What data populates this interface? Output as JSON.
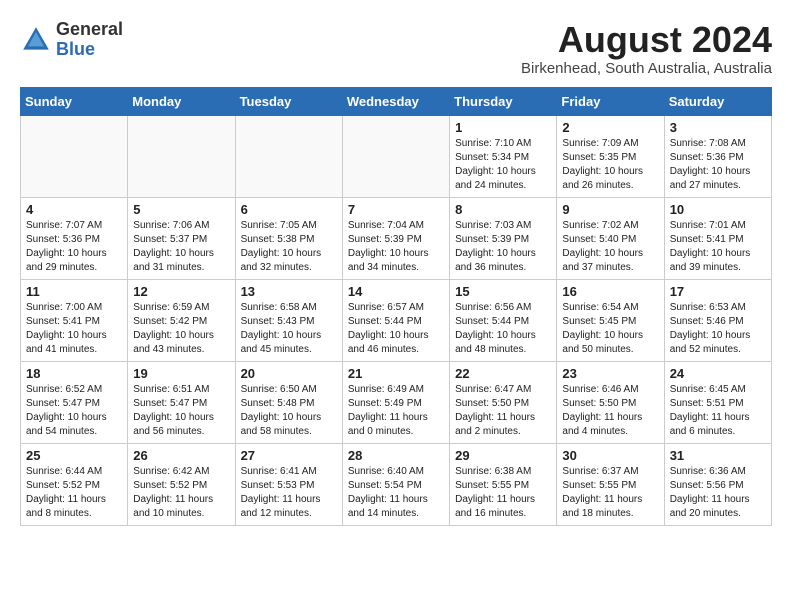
{
  "header": {
    "logo_general": "General",
    "logo_blue": "Blue",
    "month_year": "August 2024",
    "location": "Birkenhead, South Australia, Australia"
  },
  "weekdays": [
    "Sunday",
    "Monday",
    "Tuesday",
    "Wednesday",
    "Thursday",
    "Friday",
    "Saturday"
  ],
  "weeks": [
    [
      {
        "num": "",
        "info": ""
      },
      {
        "num": "",
        "info": ""
      },
      {
        "num": "",
        "info": ""
      },
      {
        "num": "",
        "info": ""
      },
      {
        "num": "1",
        "info": "Sunrise: 7:10 AM\nSunset: 5:34 PM\nDaylight: 10 hours\nand 24 minutes."
      },
      {
        "num": "2",
        "info": "Sunrise: 7:09 AM\nSunset: 5:35 PM\nDaylight: 10 hours\nand 26 minutes."
      },
      {
        "num": "3",
        "info": "Sunrise: 7:08 AM\nSunset: 5:36 PM\nDaylight: 10 hours\nand 27 minutes."
      }
    ],
    [
      {
        "num": "4",
        "info": "Sunrise: 7:07 AM\nSunset: 5:36 PM\nDaylight: 10 hours\nand 29 minutes."
      },
      {
        "num": "5",
        "info": "Sunrise: 7:06 AM\nSunset: 5:37 PM\nDaylight: 10 hours\nand 31 minutes."
      },
      {
        "num": "6",
        "info": "Sunrise: 7:05 AM\nSunset: 5:38 PM\nDaylight: 10 hours\nand 32 minutes."
      },
      {
        "num": "7",
        "info": "Sunrise: 7:04 AM\nSunset: 5:39 PM\nDaylight: 10 hours\nand 34 minutes."
      },
      {
        "num": "8",
        "info": "Sunrise: 7:03 AM\nSunset: 5:39 PM\nDaylight: 10 hours\nand 36 minutes."
      },
      {
        "num": "9",
        "info": "Sunrise: 7:02 AM\nSunset: 5:40 PM\nDaylight: 10 hours\nand 37 minutes."
      },
      {
        "num": "10",
        "info": "Sunrise: 7:01 AM\nSunset: 5:41 PM\nDaylight: 10 hours\nand 39 minutes."
      }
    ],
    [
      {
        "num": "11",
        "info": "Sunrise: 7:00 AM\nSunset: 5:41 PM\nDaylight: 10 hours\nand 41 minutes."
      },
      {
        "num": "12",
        "info": "Sunrise: 6:59 AM\nSunset: 5:42 PM\nDaylight: 10 hours\nand 43 minutes."
      },
      {
        "num": "13",
        "info": "Sunrise: 6:58 AM\nSunset: 5:43 PM\nDaylight: 10 hours\nand 45 minutes."
      },
      {
        "num": "14",
        "info": "Sunrise: 6:57 AM\nSunset: 5:44 PM\nDaylight: 10 hours\nand 46 minutes."
      },
      {
        "num": "15",
        "info": "Sunrise: 6:56 AM\nSunset: 5:44 PM\nDaylight: 10 hours\nand 48 minutes."
      },
      {
        "num": "16",
        "info": "Sunrise: 6:54 AM\nSunset: 5:45 PM\nDaylight: 10 hours\nand 50 minutes."
      },
      {
        "num": "17",
        "info": "Sunrise: 6:53 AM\nSunset: 5:46 PM\nDaylight: 10 hours\nand 52 minutes."
      }
    ],
    [
      {
        "num": "18",
        "info": "Sunrise: 6:52 AM\nSunset: 5:47 PM\nDaylight: 10 hours\nand 54 minutes."
      },
      {
        "num": "19",
        "info": "Sunrise: 6:51 AM\nSunset: 5:47 PM\nDaylight: 10 hours\nand 56 minutes."
      },
      {
        "num": "20",
        "info": "Sunrise: 6:50 AM\nSunset: 5:48 PM\nDaylight: 10 hours\nand 58 minutes."
      },
      {
        "num": "21",
        "info": "Sunrise: 6:49 AM\nSunset: 5:49 PM\nDaylight: 11 hours\nand 0 minutes."
      },
      {
        "num": "22",
        "info": "Sunrise: 6:47 AM\nSunset: 5:50 PM\nDaylight: 11 hours\nand 2 minutes."
      },
      {
        "num": "23",
        "info": "Sunrise: 6:46 AM\nSunset: 5:50 PM\nDaylight: 11 hours\nand 4 minutes."
      },
      {
        "num": "24",
        "info": "Sunrise: 6:45 AM\nSunset: 5:51 PM\nDaylight: 11 hours\nand 6 minutes."
      }
    ],
    [
      {
        "num": "25",
        "info": "Sunrise: 6:44 AM\nSunset: 5:52 PM\nDaylight: 11 hours\nand 8 minutes."
      },
      {
        "num": "26",
        "info": "Sunrise: 6:42 AM\nSunset: 5:52 PM\nDaylight: 11 hours\nand 10 minutes."
      },
      {
        "num": "27",
        "info": "Sunrise: 6:41 AM\nSunset: 5:53 PM\nDaylight: 11 hours\nand 12 minutes."
      },
      {
        "num": "28",
        "info": "Sunrise: 6:40 AM\nSunset: 5:54 PM\nDaylight: 11 hours\nand 14 minutes."
      },
      {
        "num": "29",
        "info": "Sunrise: 6:38 AM\nSunset: 5:55 PM\nDaylight: 11 hours\nand 16 minutes."
      },
      {
        "num": "30",
        "info": "Sunrise: 6:37 AM\nSunset: 5:55 PM\nDaylight: 11 hours\nand 18 minutes."
      },
      {
        "num": "31",
        "info": "Sunrise: 6:36 AM\nSunset: 5:56 PM\nDaylight: 11 hours\nand 20 minutes."
      }
    ]
  ]
}
